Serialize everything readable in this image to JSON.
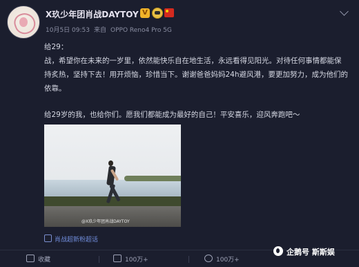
{
  "header": {
    "username": "X玖少年团肖战DAYTOY",
    "vip_badge": "V",
    "timestamp": "10月5日 09:53",
    "source_label": "来自",
    "device": "OPPO Reno4 Pro 5G"
  },
  "post": {
    "greeting": "给29：",
    "paragraph1": "战，希望你在未来的一岁里，依然能快乐自在地生活，永远看得见阳光。对待任何事情都能保持炙热，坚持下去！用开烦恼，珍惜当下。谢谢爸爸妈妈24h避风港，要更加努力，成为他们的依靠。",
    "paragraph2": "给29岁的我，也给你们。愿我们都能成为最好的自己！平安喜乐，迎风奔跑吧～"
  },
  "image": {
    "watermark": "@X玖少年团肖战DAYTOY"
  },
  "supertopic": "肖战超新粉超话",
  "actions": {
    "favorite": "收藏",
    "repost": "100万+",
    "comment": "100万+"
  },
  "source_watermark": "企鹅号 斯斯娱"
}
